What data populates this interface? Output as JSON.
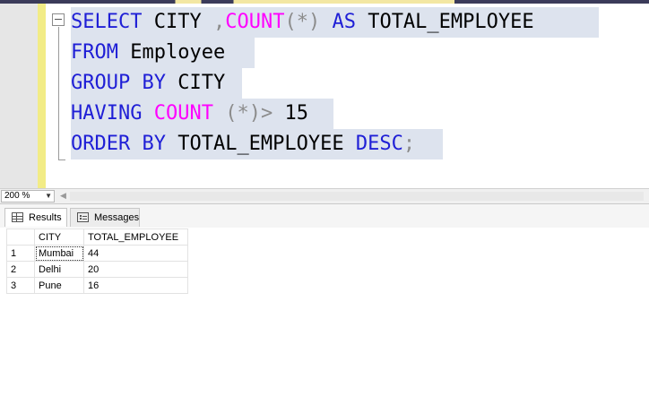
{
  "editor": {
    "lines": [
      [
        {
          "t": "SELECT",
          "c": "kw"
        },
        {
          "t": " CITY ",
          "c": "txt"
        },
        {
          "t": ",",
          "c": "op"
        },
        {
          "t": "COUNT",
          "c": "fn"
        },
        {
          "t": "(*)",
          "c": "op"
        },
        {
          "t": " ",
          "c": "txt"
        },
        {
          "t": "AS",
          "c": "kw"
        },
        {
          "t": " TOTAL_EMPLOYEE",
          "c": "txt"
        }
      ],
      [
        {
          "t": "FROM",
          "c": "kw"
        },
        {
          "t": " Employee",
          "c": "txt"
        }
      ],
      [
        {
          "t": "GROUP BY",
          "c": "kw"
        },
        {
          "t": " CITY",
          "c": "txt"
        }
      ],
      [
        {
          "t": "HAVING",
          "c": "kw"
        },
        {
          "t": " ",
          "c": "txt"
        },
        {
          "t": "COUNT",
          "c": "fn"
        },
        {
          "t": " (*)>",
          "c": "op"
        },
        {
          "t": " 15",
          "c": "txt"
        }
      ],
      [
        {
          "t": "ORDER BY",
          "c": "kw"
        },
        {
          "t": " TOTAL_EMPLOYEE ",
          "c": "txt"
        },
        {
          "t": "DESC",
          "c": "kw"
        },
        {
          "t": ";",
          "c": "op"
        }
      ]
    ]
  },
  "zoom": {
    "value": "200 %"
  },
  "tabs": {
    "results": "Results",
    "messages": "Messages"
  },
  "grid": {
    "headers": {
      "city": "CITY",
      "total": "TOTAL_EMPLOYEE"
    },
    "rows": [
      {
        "num": "1",
        "city": "Mumbai",
        "total": "44"
      },
      {
        "num": "2",
        "city": "Delhi",
        "total": "20"
      },
      {
        "num": "3",
        "city": "Pune",
        "total": "16"
      }
    ]
  },
  "colors": {
    "keyword": "#1f1fd6",
    "function": "#ff00ff",
    "operator": "#8c8c8c",
    "selection": "#dde3ee",
    "change_bar": "#f2ec86"
  }
}
